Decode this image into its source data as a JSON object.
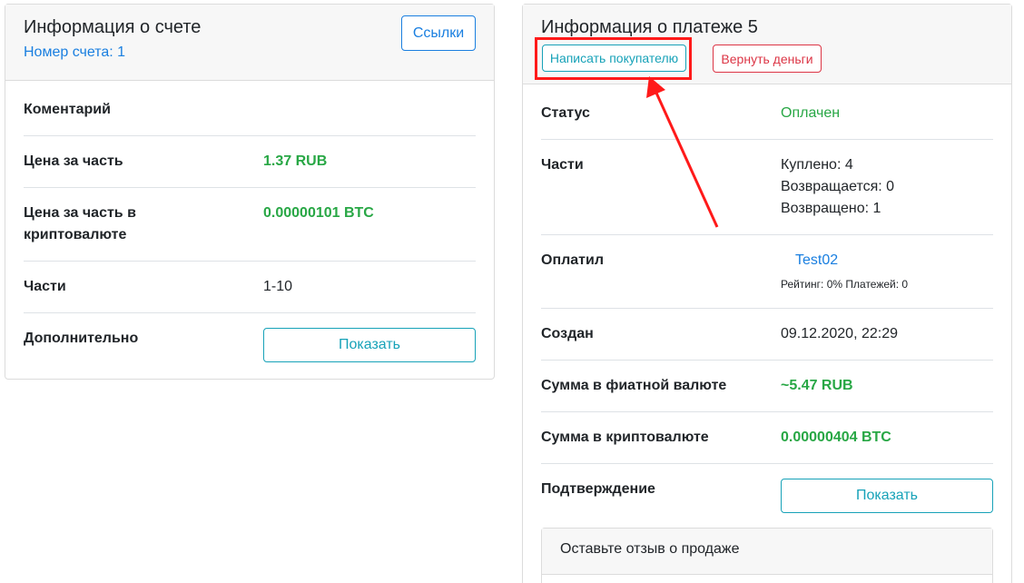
{
  "account_card": {
    "title": "Информация о счете",
    "account_number": "Номер счета: 1",
    "links_button": "Ссылки",
    "rows": {
      "comment_label": "Коментарий",
      "price_label": "Цена за часть",
      "price_value": "1.37 RUB",
      "crypto_price_label_line1": "Цена за часть в",
      "crypto_price_label_line2": "криптовалюте",
      "crypto_price_value": "0.00000101 BTC",
      "parts_label": "Части",
      "parts_value": "1-10",
      "extra_label": "Дополнительно",
      "show_button": "Показать"
    }
  },
  "payment_card": {
    "title": "Информация о платеже 5",
    "write_buyer_button": "Написать покупателю",
    "refund_button": "Вернуть деньги",
    "rows": {
      "status_label": "Статус",
      "status_value": "Оплачен",
      "parts_label": "Части",
      "bought": "Куплено: 4",
      "returning": "Возвращается: 0",
      "returned": "Возвращено: 1",
      "paid_by_label": "Оплатил",
      "buyer_name": "Test02",
      "buyer_stats": "Рейтинг: 0% Платежей: 0",
      "created_label": "Создан",
      "created_value": "09.12.2020, 22:29",
      "fiat_sum_label": "Сумма в фиатной валюте",
      "fiat_sum_value": "~5.47 RUB",
      "crypto_sum_label": "Сумма в криптовалюте",
      "crypto_sum_value": "0.00000404 BTC",
      "confirmation_label": "Подтверждение",
      "show_button": "Показать"
    },
    "review": {
      "title": "Оставьте отзыв о продаже"
    }
  },
  "colors": {
    "accent_blue": "#1a7fe0",
    "teal": "#17a2b8",
    "red": "#dc3545",
    "green": "#28a745",
    "annotation_red": "#ff1a1a"
  }
}
